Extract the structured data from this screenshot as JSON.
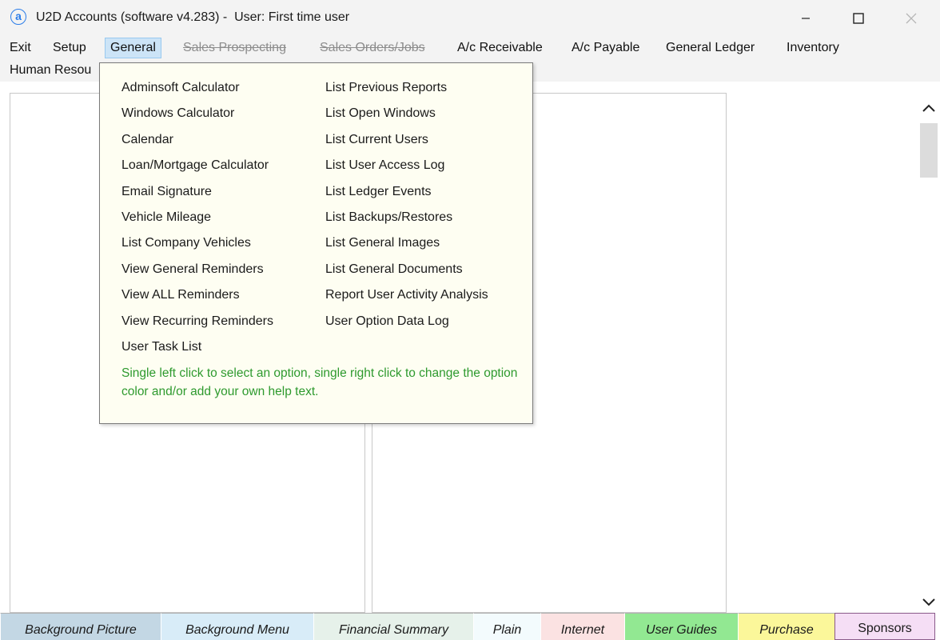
{
  "window": {
    "title": "U2D Accounts (software v4.283) -  User: First time user",
    "app_icon": "a"
  },
  "menubar": {
    "items": [
      {
        "label": "Exit",
        "state": "normal"
      },
      {
        "label": "Setup",
        "state": "normal"
      },
      {
        "label": "General",
        "state": "active"
      },
      {
        "label": "Sales Prospecting",
        "state": "disabled"
      },
      {
        "label": "Sales Orders/Jobs",
        "state": "disabled"
      },
      {
        "label": "A/c Receivable",
        "state": "normal"
      },
      {
        "label": "A/c Payable",
        "state": "normal"
      },
      {
        "label": "General Ledger",
        "state": "normal"
      },
      {
        "label": "Inventory",
        "state": "normal"
      },
      {
        "label": "Human Resou",
        "state": "normal"
      }
    ]
  },
  "dropdown": {
    "left_column": [
      "Adminsoft Calculator",
      "Windows Calculator",
      "Calendar",
      "Loan/Mortgage Calculator",
      "Email Signature",
      "Vehicle Mileage",
      "List Company Vehicles",
      "View General Reminders",
      "View ALL Reminders",
      "View Recurring Reminders",
      "User Task List"
    ],
    "right_column": [
      "List Previous Reports",
      "List Open Windows",
      "List Current Users",
      "List User Access Log",
      "List Ledger Events",
      "List Backups/Restores",
      "List General Images",
      "List General Documents",
      "Report User Activity Analysis",
      "User Option Data Log"
    ],
    "help_text": "Single left click to select an option, single right click to change the option color and/or add your own help text.",
    "background_color": "#fefef2",
    "help_color": "#2e9a2e"
  },
  "bottom_tabs": [
    {
      "label": "Background Picture",
      "color": "#c3d7e4"
    },
    {
      "label": "Background Menu",
      "color": "#d8ecf8"
    },
    {
      "label": "Financial Summary",
      "color": "#e6f1ea"
    },
    {
      "label": "Plain",
      "color": "#f3fbfd"
    },
    {
      "label": "Internet",
      "color": "#fbe2e2"
    },
    {
      "label": "User Guides",
      "color": "#92e892"
    },
    {
      "label": "Purchase",
      "color": "#fbf79a"
    },
    {
      "label": "Sponsors",
      "color": "#f5def5"
    }
  ],
  "icons": {
    "minimize": "minimize-icon",
    "maximize": "maximize-icon",
    "close": "close-icon",
    "scroll_up": "chevron-up-icon",
    "scroll_down": "chevron-down-icon"
  }
}
